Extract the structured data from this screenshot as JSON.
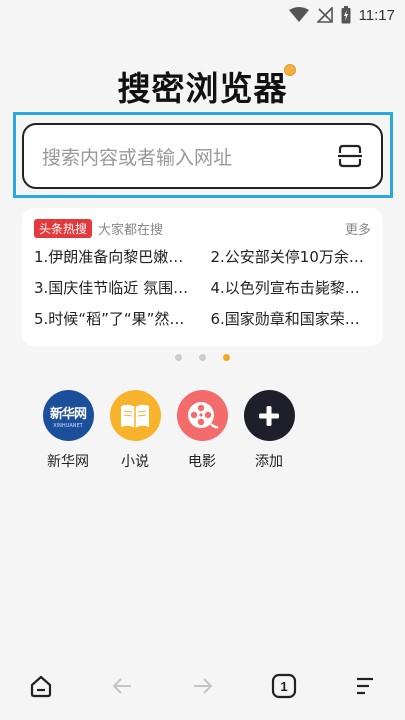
{
  "status_bar": {
    "time": "11:17"
  },
  "header": {
    "title": "搜密浏览器"
  },
  "search": {
    "placeholder": "搜索内容或者输入网址"
  },
  "hot": {
    "badge": "头条热搜",
    "subtitle": "大家都在搜",
    "more": "更多",
    "items": [
      "1.伊朗准备向黎巴嫩…",
      "2.公安部关停10万余…",
      "3.国庆佳节临近 氛围…",
      "4.以色列宣布击毙黎…",
      "5.时候“稻”了“果”然好…",
      "6.国家勋章和国家荣…"
    ]
  },
  "pager": {
    "count": 3,
    "active": 3
  },
  "shortcuts": [
    {
      "label": "新华网",
      "icon": "xinhua-logo-icon",
      "logo_text": "新华网",
      "logo_sub": "XINHUANET",
      "color": "#1b4f9b"
    },
    {
      "label": "小说",
      "icon": "book-icon",
      "color": "#f7b32b"
    },
    {
      "label": "电影",
      "icon": "film-reel-icon",
      "color": "#f36b6b"
    },
    {
      "label": "添加",
      "icon": "plus-icon",
      "color": "#1f1f2b"
    }
  ],
  "bottom_nav": {
    "tab_count": "1",
    "items": [
      "home-icon",
      "back-arrow-icon",
      "forward-arrow-icon",
      "tabs-icon",
      "menu-icon"
    ]
  },
  "colors": {
    "accent_orange": "#f5a623",
    "highlight_blue": "#29a9dd",
    "hot_badge_red": "#e4393c"
  }
}
